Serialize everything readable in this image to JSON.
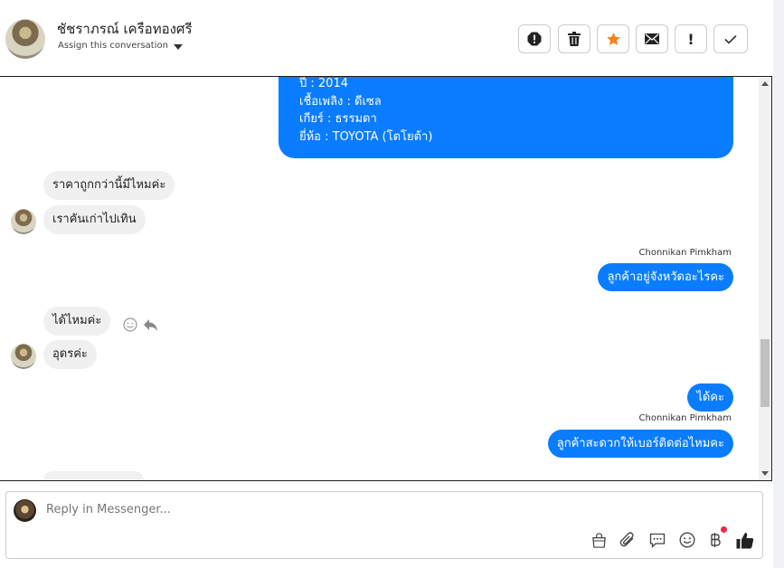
{
  "header": {
    "contact_name": "ชัชราภรณ์ เครือทองศรี",
    "assign_label": "Assign this conversation",
    "actions": [
      {
        "icon": "spam-alert-icon"
      },
      {
        "icon": "trash-icon"
      },
      {
        "icon": "star-icon",
        "color": "#f5821f"
      },
      {
        "icon": "envelope-icon"
      },
      {
        "icon": "exclamation-icon",
        "text": "!"
      },
      {
        "icon": "checkmark-icon"
      }
    ]
  },
  "conversation": {
    "card": {
      "lines": [
        "ปี : 2014",
        "เชื้อเพลิง : ดีเซล",
        "เกียร์ : ธรรมดา",
        "ยี่ห้อ : TOYOTA (โตโยต้า)"
      ]
    },
    "messages": [
      {
        "from": "customer",
        "text": "ราคาถูกกว่านี้มีไหมค่ะ"
      },
      {
        "from": "customer",
        "text": "เราคันเก่าไปเทิน"
      },
      {
        "from": "page",
        "sender": "Chonnikan Pimkham",
        "text": "ลูกค้าอยู่จังหวัดอะไรคะ"
      },
      {
        "from": "customer",
        "text": "ได้ไหมค่ะ"
      },
      {
        "from": "customer",
        "text": "อุดรค่ะ"
      },
      {
        "from": "page",
        "text": "ได้คะ"
      },
      {
        "from": "page",
        "sender": "Chonnikan Pimkham",
        "text": "ลูกค้าสะดวกให้เบอร์ติดต่อไหมคะ"
      }
    ]
  },
  "reply": {
    "placeholder": "Reply in Messenger...",
    "tools": [
      "shopping-bag-icon",
      "paperclip-icon",
      "saved-reply-icon",
      "emoji-icon",
      "baht-payment-icon",
      "thumbs-up-icon"
    ]
  },
  "colors": {
    "outgoing_bubble": "#0a7cff",
    "incoming_bubble": "#f0f0f0",
    "notification_dot": "#f02849"
  }
}
